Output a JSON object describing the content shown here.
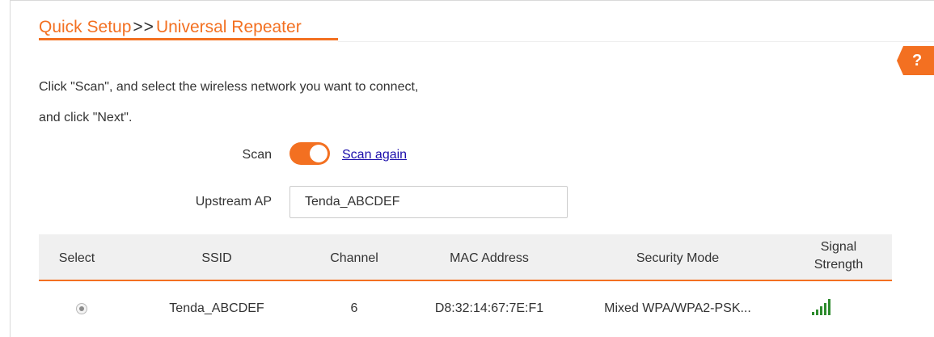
{
  "breadcrumb": {
    "parent": "Quick Setup",
    "separator": ">>",
    "current": "Universal Repeater"
  },
  "help": {
    "icon": "help-icon",
    "label": "?"
  },
  "intro": {
    "line1": "Click \"Scan\", and select the wireless network you want to connect,",
    "line2": "and click \"Next\"."
  },
  "scan": {
    "label": "Scan",
    "enabled": true,
    "rescan_link": "Scan again"
  },
  "upstream_ap": {
    "label": "Upstream AP",
    "value": "Tenda_ABCDEF"
  },
  "table": {
    "headers": {
      "select": "Select",
      "ssid": "SSID",
      "channel": "Channel",
      "mac": "MAC Address",
      "security": "Security Mode",
      "signal_line1": "Signal",
      "signal_line2": "Strength"
    },
    "rows": [
      {
        "selected": true,
        "ssid": "Tenda_ABCDEF",
        "channel": "6",
        "mac": "D8:32:14:67:7E:F1",
        "security": "Mixed WPA/WPA2-PSK...",
        "signal_icon": "signal-strength-icon"
      }
    ]
  },
  "colors": {
    "accent": "#f37021",
    "link": "#1a0dab",
    "signal": "#2e8b2e",
    "header_bg": "#f0f0f0"
  }
}
